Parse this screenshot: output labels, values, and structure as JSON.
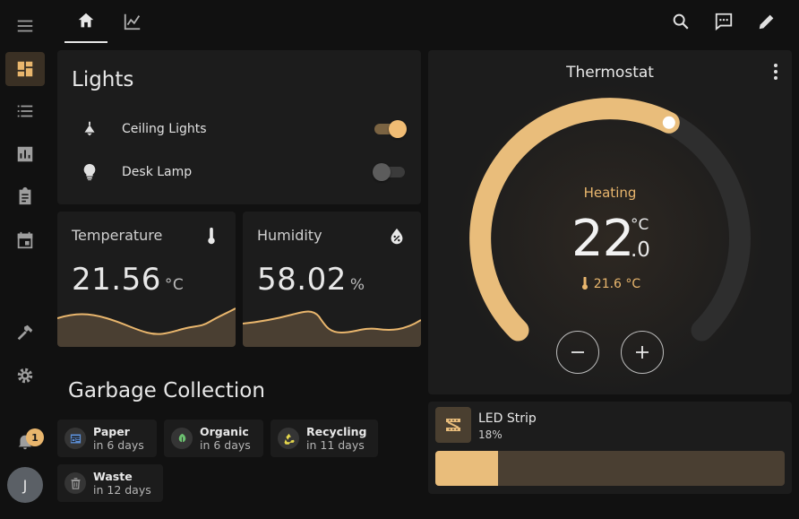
{
  "colors": {
    "accent": "#e9b66d",
    "background": "#111111",
    "card": "#1c1c1c"
  },
  "sidebar": {
    "items": [
      {
        "icon": "dashboard-icon",
        "active": true
      },
      {
        "icon": "list-icon",
        "active": false
      },
      {
        "icon": "chart-icon",
        "active": false
      },
      {
        "icon": "clipboard-icon",
        "active": false
      },
      {
        "icon": "calendar-icon",
        "active": false
      },
      {
        "icon": "hammer-icon",
        "active": false
      },
      {
        "icon": "gear-icon",
        "active": false
      }
    ],
    "notifications_count": "1",
    "avatar_initial": "J"
  },
  "topbar": {
    "tabs": [
      {
        "icon": "home-icon",
        "active": true
      },
      {
        "icon": "chart-line-icon",
        "active": false
      }
    ],
    "actions": [
      "search-icon",
      "assist-icon",
      "pencil-icon"
    ]
  },
  "lights": {
    "title": "Lights",
    "items": [
      {
        "label": "Ceiling Lights",
        "icon": "ceiling-light-icon",
        "on": true
      },
      {
        "label": "Desk Lamp",
        "icon": "bulb-icon",
        "on": false
      }
    ]
  },
  "sensors": [
    {
      "name": "Temperature",
      "value": "21.56",
      "unit": "°C",
      "icon": "thermometer-icon"
    },
    {
      "name": "Humidity",
      "value": "58.02",
      "unit": "%",
      "icon": "water-percent-icon"
    }
  ],
  "garbage": {
    "title": "Garbage Collection",
    "items": [
      {
        "name": "Paper",
        "when": "in 6 days",
        "icon": "newspaper-icon",
        "color": "#5c8fd6"
      },
      {
        "name": "Organic",
        "when": "in 6 days",
        "icon": "leaf-icon",
        "color": "#6cc070"
      },
      {
        "name": "Recycling",
        "when": "in 11 days",
        "icon": "recycle-icon",
        "color": "#e6d84c"
      },
      {
        "name": "Waste",
        "when": "in 12 days",
        "icon": "trash-icon",
        "color": "#9e9e9e"
      }
    ]
  },
  "thermostat": {
    "title": "Thermostat",
    "mode_label": "Heating",
    "target_whole": "22",
    "target_decimal": ".0",
    "target_unit": "°C",
    "current_label": "21.6 °C",
    "target_fraction": 0.6
  },
  "led": {
    "name": "LED Strip",
    "state": "18%",
    "brightness": 0.18
  }
}
